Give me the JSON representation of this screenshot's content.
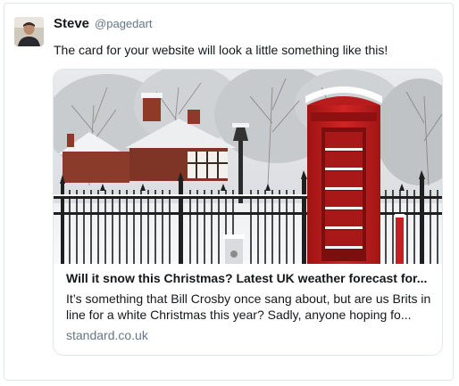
{
  "tweet": {
    "display_name": "Steve",
    "handle": "@pagedart",
    "text": "The card for your website will look a little something like this!"
  },
  "card": {
    "title": "Will it snow this Christmas? Latest UK weather forecast for...",
    "description": "It’s something that Bill Crosby once sang about, but are us Brits in line for a white Christmas this year? Sadly, anyone hoping fo...",
    "domain": "standard.co.uk"
  },
  "colors": {
    "secondary_text": "#657786",
    "border": "#e1e8ed",
    "phone_box_red": "#c41f1f"
  },
  "icons": {
    "avatar": "user-avatar"
  }
}
